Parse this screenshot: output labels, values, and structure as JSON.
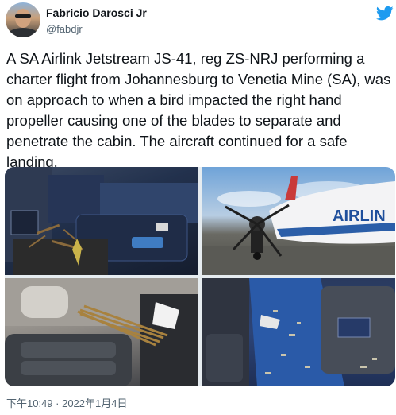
{
  "user": {
    "name": "Fabricio Darosci Jr",
    "handle": "@fabdjr"
  },
  "tweet": {
    "text": "A SA Airlink Jetstream JS-41, reg ZS-NRJ performing a charter flight from Johannesburg to Venetia Mine (SA), was on approach to when a bird impacted the right hand propeller causing one of the blades to separate and penetrate the cabin. The aircraft continued for a safe landing.",
    "timestamp": "下午10:49 · 2022年1月4日"
  },
  "media": {
    "photo2_aircraft_text": "AIRLIN"
  },
  "icons": {
    "platform_logo": "bird-logo-icon"
  },
  "colors": {
    "text_primary": "#0f1419",
    "text_secondary": "#536471",
    "logo_blue": "#1d9bf0"
  }
}
